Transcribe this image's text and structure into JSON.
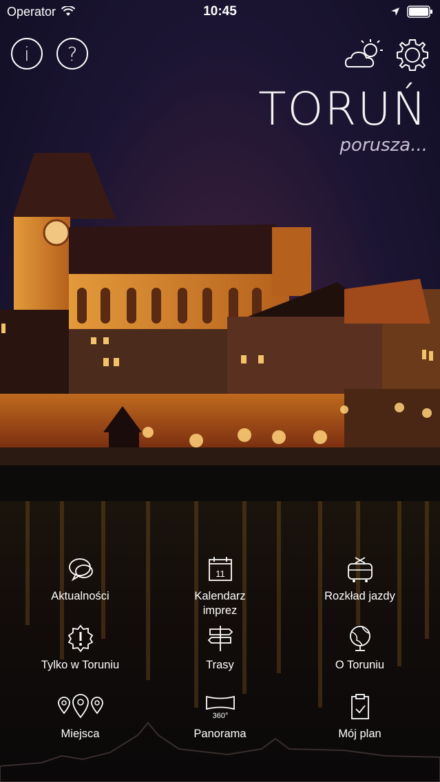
{
  "status_bar": {
    "carrier": "Operator",
    "time": "10:45"
  },
  "header": {
    "info_label": "i",
    "help_label": "?",
    "city_title": "TORUŃ",
    "tagline": "porusza..."
  },
  "menu": {
    "items": [
      {
        "label": "Aktualności",
        "icon": "chat-bubbles-icon"
      },
      {
        "label": "Kalendarz\nimprez",
        "icon": "calendar-icon",
        "badge": "11"
      },
      {
        "label": "Rozkład jazdy",
        "icon": "tram-icon"
      },
      {
        "label": "Tylko w Toruniu",
        "icon": "exclamation-badge-icon"
      },
      {
        "label": "Trasy",
        "icon": "signpost-icon"
      },
      {
        "label": "O Toruniu",
        "icon": "globe-icon"
      },
      {
        "label": "Miejsca",
        "icon": "map-pins-icon"
      },
      {
        "label": "Panorama",
        "icon": "panorama-360-icon",
        "badge": "360°"
      },
      {
        "label": "Mój plan",
        "icon": "clipboard-check-icon"
      }
    ]
  }
}
